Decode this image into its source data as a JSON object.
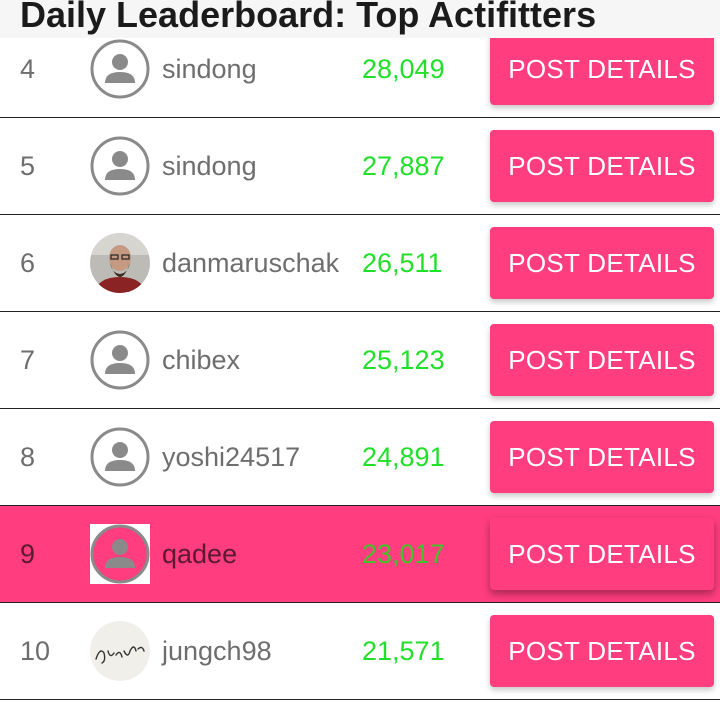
{
  "header": {
    "title": "Daily Leaderboard: Top Actifitters"
  },
  "button_label": "POST DETAILS",
  "colors": {
    "accent": "#ff3d7f",
    "score": "#22e02a",
    "text": "#6e6e6e"
  },
  "rows": [
    {
      "rank": "4",
      "username": "sindong",
      "score": "28,049",
      "avatar": "default-avatar-icon"
    },
    {
      "rank": "5",
      "username": "sindong",
      "score": "27,887",
      "avatar": "default-avatar-icon"
    },
    {
      "rank": "6",
      "username": "danmaruschak",
      "score": "26,511",
      "avatar": "photo-avatar"
    },
    {
      "rank": "7",
      "username": "chibex",
      "score": "25,123",
      "avatar": "default-avatar-icon"
    },
    {
      "rank": "8",
      "username": "yoshi24517",
      "score": "24,891",
      "avatar": "default-avatar-icon"
    },
    {
      "rank": "9",
      "username": "qadee",
      "score": "23,017",
      "avatar": "default-avatar-icon",
      "highlighted": true
    },
    {
      "rank": "10",
      "username": "jungch98",
      "score": "21,571",
      "avatar": "signature-avatar",
      "avatar_text": "Jungch98"
    }
  ]
}
